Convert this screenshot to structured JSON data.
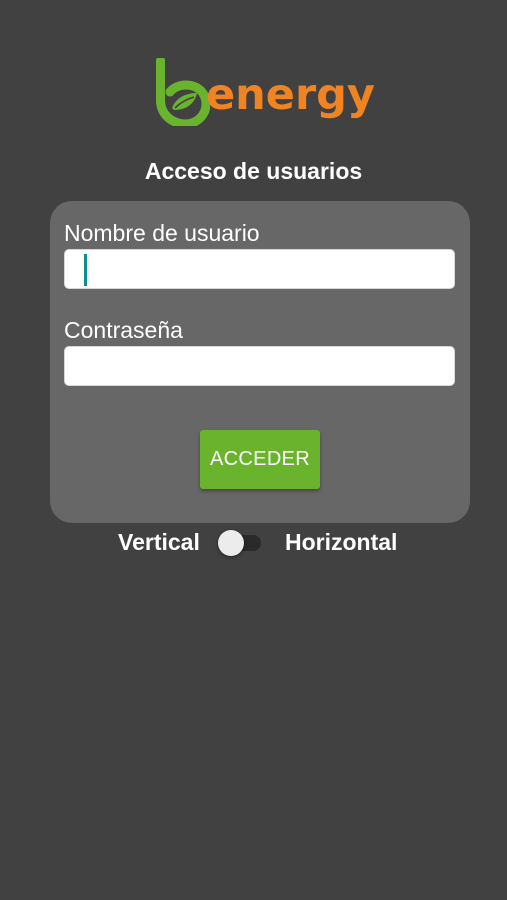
{
  "brand": {
    "logo_b_glyph": "b",
    "logo_word": "energy",
    "green": "#6ab42d",
    "orange": "#f08423"
  },
  "login": {
    "title": "Acceso de usuarios",
    "username_label": "Nombre de usuario",
    "username_value": "",
    "password_label": "Contraseña",
    "password_value": "",
    "submit_label": "ACCEDER"
  },
  "orientation": {
    "left_label": "Vertical",
    "right_label": "Horizontal",
    "toggle_on": false
  },
  "colors": {
    "background": "#414141",
    "card": "#676767",
    "caret": "#0f8f8a"
  }
}
